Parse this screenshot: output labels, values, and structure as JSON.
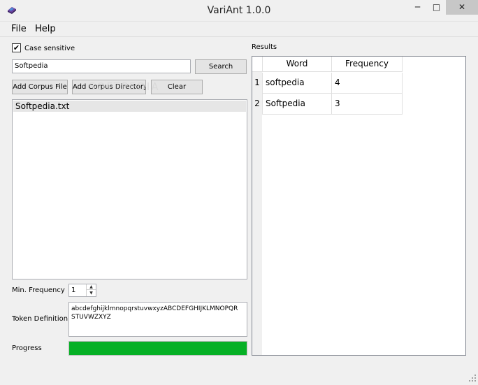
{
  "window": {
    "title": "VariAnt 1.0.0",
    "minimize_glyph": "─",
    "maximize_glyph": "□",
    "close_glyph": "✕",
    "app_icon": "variant-app-icon"
  },
  "menu": {
    "items": [
      "File",
      "Help"
    ]
  },
  "search_options": {
    "case_sensitive_label": "Case sensitive",
    "case_sensitive_checked": true,
    "check_glyph": "✔"
  },
  "search": {
    "query": "Softpedia",
    "button_label": "Search"
  },
  "corpus": {
    "add_file_label": "Add Corpus File",
    "add_directory_label": "Add Corpus Directory",
    "clear_label": "Clear",
    "files": [
      "Softpedia.txt"
    ]
  },
  "min_frequency": {
    "label": "Min. Frequency",
    "value": "1",
    "up_glyph": "▲",
    "down_glyph": "▼"
  },
  "token_definition": {
    "label": "Token Definition",
    "value_line1": "abcdefghijklmnopqrstuvwxyzABCDEFGHIJKLMNOPQR",
    "value_line2": "STUVWZXYZ"
  },
  "progress": {
    "label": "Progress",
    "fraction": 1.0,
    "color": "#06b025"
  },
  "results": {
    "label": "Results",
    "columns": [
      "Word",
      "Frequency"
    ],
    "rows": [
      {
        "index": "1",
        "word": "softpedia",
        "frequency": "4"
      },
      {
        "index": "2",
        "word": "Softpedia",
        "frequency": "3"
      }
    ]
  },
  "watermark": "SOFTPEDIA"
}
